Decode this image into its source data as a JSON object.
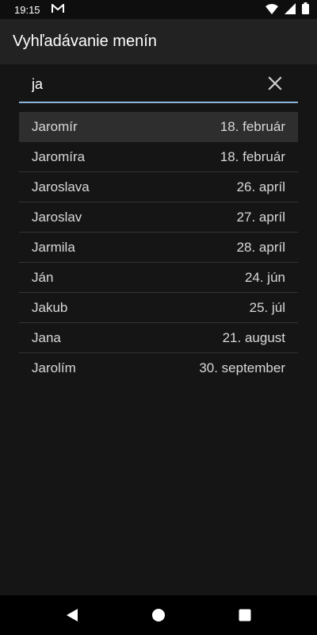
{
  "status_bar": {
    "time": "19:15",
    "notification_icon": "gmail-icon",
    "icons": [
      "wifi-icon",
      "signal-icon",
      "battery-icon"
    ]
  },
  "app_bar": {
    "title": "Vyhľadávanie menín"
  },
  "search": {
    "value": "ja",
    "clear_icon": "close-icon",
    "underline_color": "#8ab4d8"
  },
  "results": [
    {
      "name": "Jaromír",
      "date": "18. február",
      "selected": true
    },
    {
      "name": "Jaromíra",
      "date": "18. február"
    },
    {
      "name": "Jaroslava",
      "date": "26. apríl"
    },
    {
      "name": "Jaroslav",
      "date": "27. apríl"
    },
    {
      "name": "Jarmila",
      "date": "28. apríl"
    },
    {
      "name": "Ján",
      "date": "24. jún"
    },
    {
      "name": "Jakub",
      "date": "25. júl"
    },
    {
      "name": "Jana",
      "date": "21. august"
    },
    {
      "name": "Jarolím",
      "date": "30. september"
    }
  ],
  "nav_bar": {
    "icons": [
      "back-icon",
      "home-icon",
      "recents-icon"
    ]
  }
}
